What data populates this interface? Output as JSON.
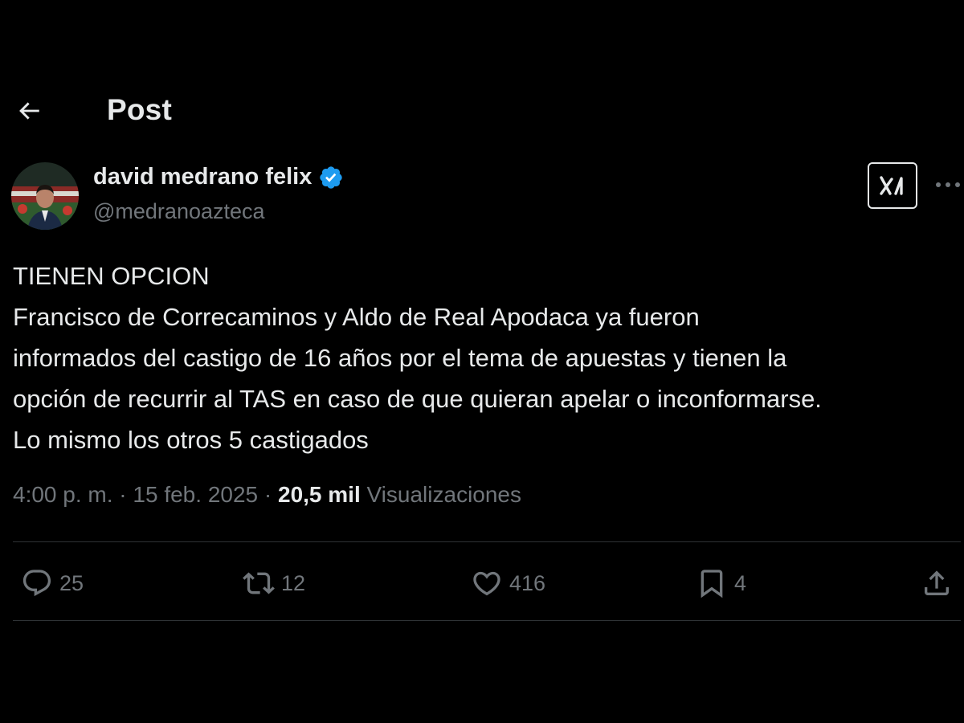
{
  "header": {
    "title": "Post",
    "back_icon": "arrow-left-icon"
  },
  "author": {
    "name": "david medrano felix",
    "handle": "@medranoazteca",
    "verified": true,
    "verified_color": "#1d9bf0",
    "avatar_icon": "avatar-photo"
  },
  "toolbar": {
    "grok_icon": "grok-icon",
    "more_icon": "more-dots-icon"
  },
  "post": {
    "lines": [
      "TIENEN OPCION",
      "Francisco de Correcaminos y Aldo de Real Apodaca ya fueron",
      "informados del castigo de 16 años por el tema de apuestas y tienen la",
      "opción de recurrir al TAS en caso de que quieran apelar o inconformarse.",
      "Lo mismo los otros 5 castigados"
    ]
  },
  "meta": {
    "time": "4:00 p. m.",
    "separator": "·",
    "date": "15 feb. 2025",
    "views_count": "20,5 mil",
    "views_label": "Visualizaciones"
  },
  "actions": {
    "replies": "25",
    "reposts": "12",
    "likes": "416",
    "bookmarks": "4"
  },
  "colors": {
    "background": "#000000",
    "text": "#e7e9ea",
    "muted": "#71767b",
    "divider": "#2f3336"
  }
}
